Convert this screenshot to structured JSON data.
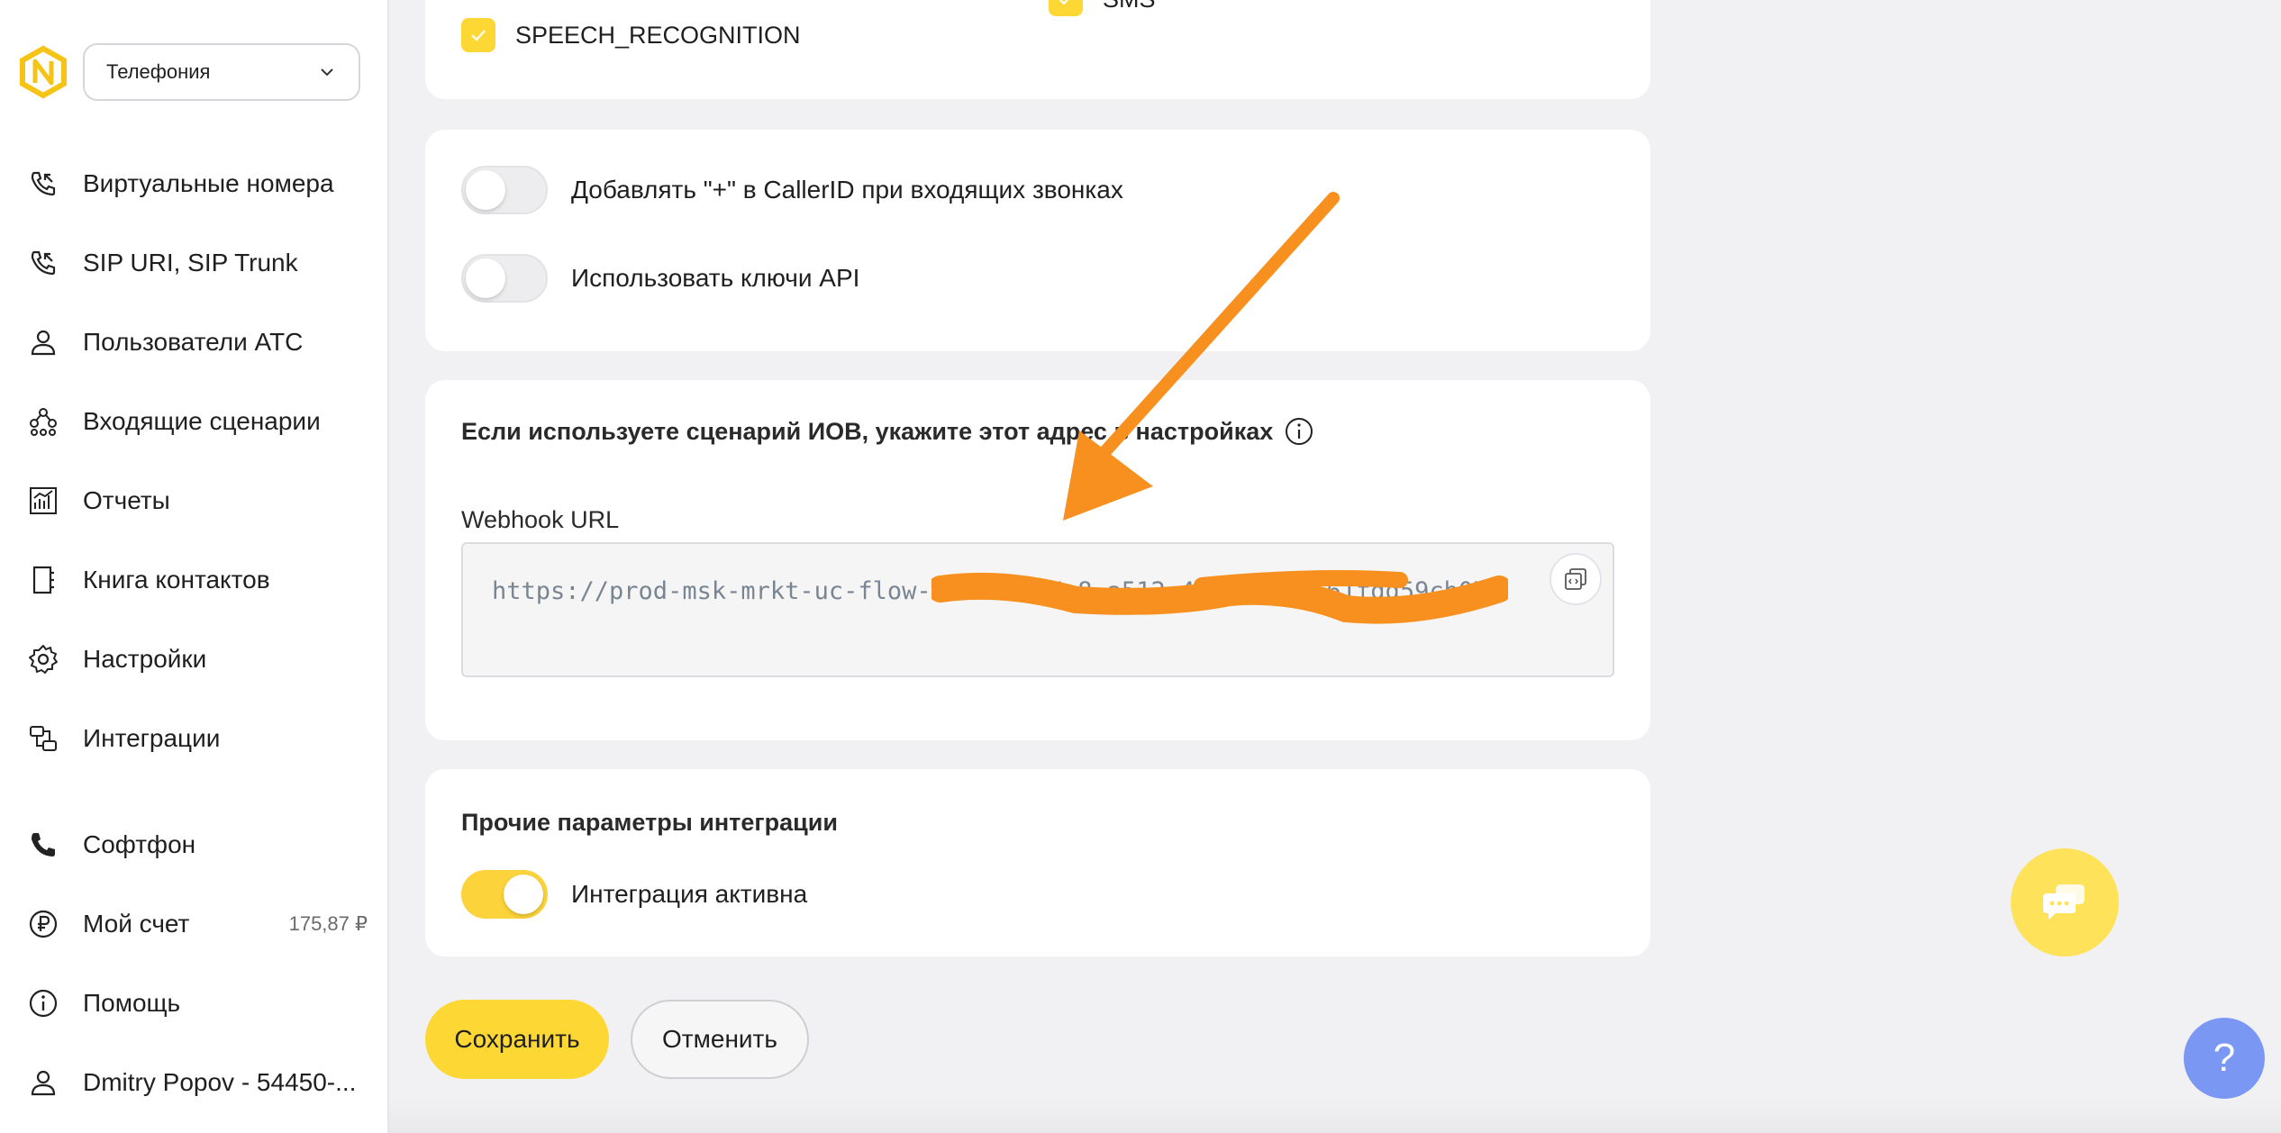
{
  "sidebar": {
    "product_select": "Телефония",
    "items": [
      {
        "label": "Виртуальные номера",
        "icon": "phone-incoming-icon"
      },
      {
        "label": "SIP URI, SIP Trunk",
        "icon": "phone-incoming-icon"
      },
      {
        "label": "Пользователи АТС",
        "icon": "user-icon"
      },
      {
        "label": "Входящие сценарии",
        "icon": "scenario-tree-icon"
      },
      {
        "label": "Отчеты",
        "icon": "report-chart-icon"
      },
      {
        "label": "Книга контактов",
        "icon": "contact-book-icon"
      },
      {
        "label": "Настройки",
        "icon": "gear-icon"
      },
      {
        "label": "Интеграции",
        "icon": "integrations-icon"
      },
      {
        "label": "Софтфон",
        "icon": "phone-icon"
      },
      {
        "label": "Мой счет",
        "icon": "ruble-icon",
        "balance": "175,87 ₽"
      },
      {
        "label": "Помощь",
        "icon": "info-icon"
      },
      {
        "label": "Dmitry Popov - 54450-...",
        "icon": "user-icon"
      }
    ]
  },
  "permissions": {
    "speech_recognition": "SPEECH_RECOGNITION",
    "sms": "SMS"
  },
  "options": {
    "add_plus_callerid": "Добавлять \"+\" в CallerID при входящих звонках",
    "use_api_keys": "Использовать ключи API"
  },
  "webhook": {
    "title": "Если используете сценарий ИОВ, укажите этот адрес в настройках",
    "label": "Webhook URL",
    "value": "https://prod-msk-mrkt-uc-flow-w          k.nov             /          8          a512-442f-bb39-61fdd59cb07e"
  },
  "other": {
    "title": "Прочие параметры интеграции",
    "integration_active": "Интеграция активна"
  },
  "actions": {
    "save": "Сохранить",
    "cancel": "Отменить"
  },
  "help_label": "?",
  "colors": {
    "accent": "#fdd835",
    "annotation_arrow": "#f7901e",
    "help_fab": "#7a98f3"
  }
}
